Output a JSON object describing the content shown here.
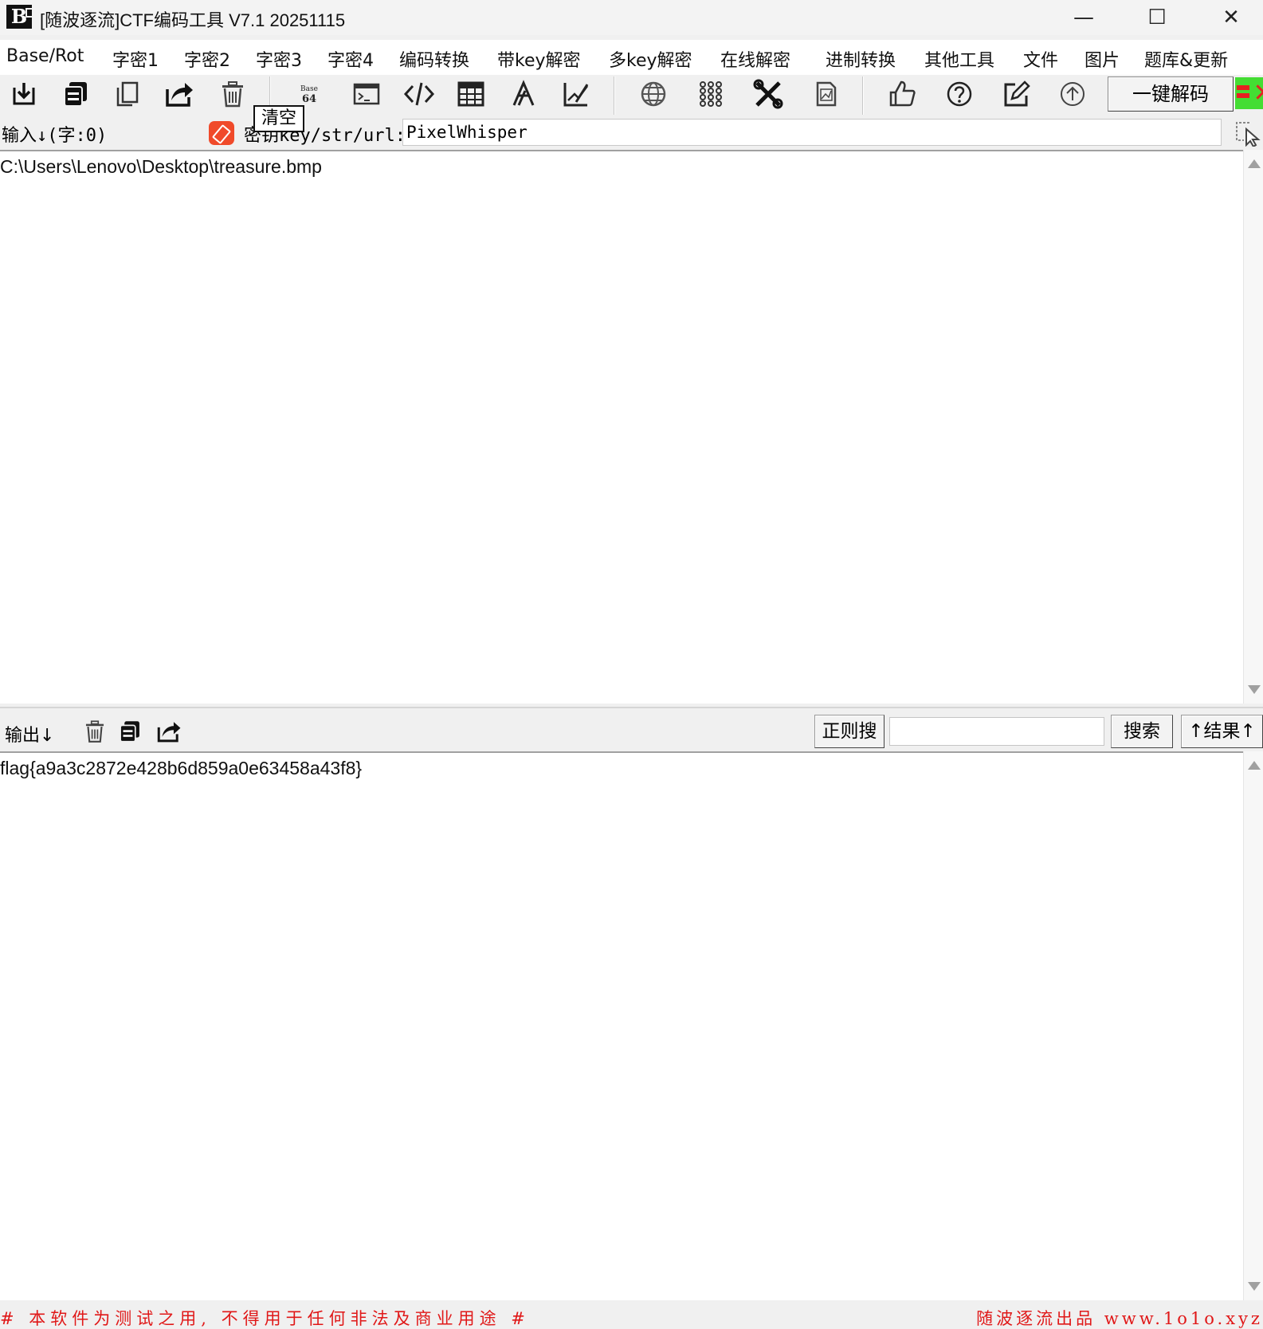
{
  "window": {
    "logo": "B",
    "title": "[随波逐流]CTF编码工具 V7.1  20251115",
    "minimize": "—",
    "maximize": "☐",
    "close": "✕"
  },
  "menu": [
    "Base/Rot",
    "字密1",
    "字密2",
    "字密3",
    "字密4",
    "编码转换",
    "带key解密",
    "多key解密",
    "在线解密",
    "进制转换",
    "其他工具",
    "文件",
    "图片",
    "题库&更新"
  ],
  "toolbar": {
    "base64_top": "Base",
    "base64_bottom": "64",
    "decode_all": "一键解码"
  },
  "tooltip": "清空",
  "input": {
    "label": "输入↓(字:0)",
    "key_label": "密钥key/str/url:",
    "key_value": "PixelWhisper",
    "text": "C:\\Users\\Lenovo\\Desktop\\treasure.bmp"
  },
  "output": {
    "label": "输出↓",
    "regex_button": "正则搜",
    "search_value": "",
    "search_button": "搜索",
    "result_button": "↑结果↑",
    "text": "flag{a9a3c2872e428b6d859a0e63458a43f8}"
  },
  "footer": {
    "left": "# 本软件为测试之用, 不得用于任何非法及商业用途 #",
    "right": "随波逐流出品 www.1o1o.xyz"
  },
  "colors": {
    "footer_text": "#e01818",
    "eraser": "#f04a2a",
    "indicator_green": "#44dd33"
  }
}
